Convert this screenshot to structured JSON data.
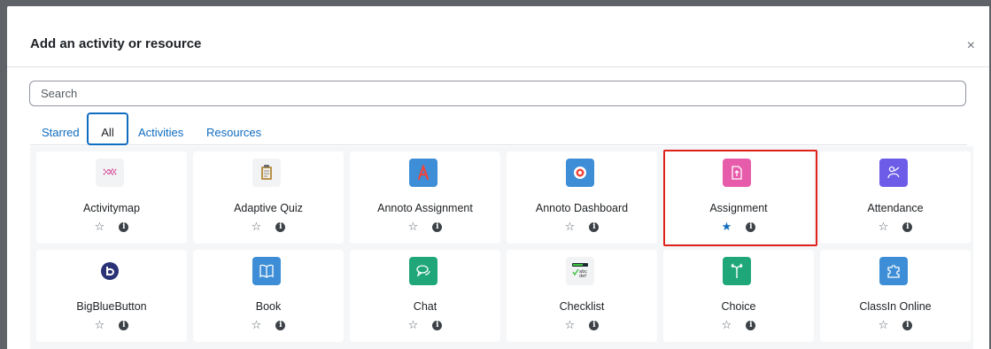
{
  "modal": {
    "title": "Add an activity or resource",
    "close_glyph": "×"
  },
  "search": {
    "placeholder": "Search",
    "value": ""
  },
  "tabs": [
    {
      "label": "Starred",
      "active": false
    },
    {
      "label": "All",
      "active": true
    },
    {
      "label": "Activities",
      "active": false
    },
    {
      "label": "Resources",
      "active": false
    }
  ],
  "items": [
    {
      "name": "Activitymap",
      "icon": "activitymap-icon",
      "icon_bg": "#f2f3f5",
      "starred": false
    },
    {
      "name": "Adaptive Quiz",
      "icon": "clipboard-icon",
      "icon_bg": "#f2f3f5",
      "starred": false
    },
    {
      "name": "Annoto Assignment",
      "icon": "annoto-a-icon",
      "icon_bg": "#3d8ed6",
      "starred": false
    },
    {
      "name": "Annoto Dashboard",
      "icon": "annoto-dashboard-icon",
      "icon_bg": "#3d8ed6",
      "starred": false
    },
    {
      "name": "Assignment",
      "icon": "assignment-upload-icon",
      "icon_bg": "#e75bab",
      "starred": true
    },
    {
      "name": "Attendance",
      "icon": "attendance-hand-icon",
      "icon_bg": "#6c5ce7",
      "starred": false
    },
    {
      "name": "BigBlueButton",
      "icon": "bigbluebutton-icon",
      "icon_bg": "#ffffff",
      "starred": false
    },
    {
      "name": "Book",
      "icon": "book-icon",
      "icon_bg": "#3d8ed6",
      "starred": false
    },
    {
      "name": "Chat",
      "icon": "chat-bubbles-icon",
      "icon_bg": "#1fa77a",
      "starred": false
    },
    {
      "name": "Checklist",
      "icon": "checklist-icon",
      "icon_bg": "#f2f3f5",
      "starred": false
    },
    {
      "name": "Choice",
      "icon": "choice-signpost-icon",
      "icon_bg": "#1fa77a",
      "starred": false
    },
    {
      "name": "ClassIn Online",
      "icon": "puzzle-icon",
      "icon_bg": "#3d8ed6",
      "starred": false
    }
  ],
  "colors": {
    "link": "#0f6cbf",
    "highlight": "#e0201a",
    "star_filled": "#0f6cbf"
  },
  "glyphs": {
    "star_empty": "☆",
    "star_filled": "★",
    "info": "i",
    "checklist_text": "abc def"
  }
}
